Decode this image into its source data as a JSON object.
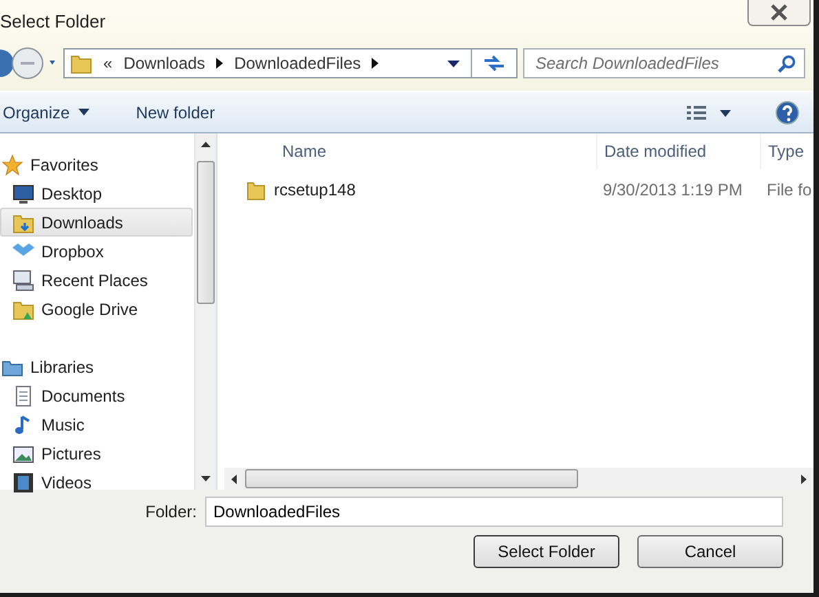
{
  "window": {
    "title": "Select Folder"
  },
  "address": {
    "crumbs": [
      "«",
      "Downloads",
      "DownloadedFiles"
    ]
  },
  "search": {
    "placeholder": "Search DownloadedFiles"
  },
  "toolbar": {
    "organize": "Organize",
    "new_folder": "New folder"
  },
  "nav": [
    {
      "kind": "group",
      "label": "Favorites",
      "selected": false
    },
    {
      "kind": "item",
      "label": "Desktop",
      "selected": false
    },
    {
      "kind": "item",
      "label": "Downloads",
      "selected": true
    },
    {
      "kind": "item",
      "label": "Dropbox",
      "selected": false
    },
    {
      "kind": "item",
      "label": "Recent Places",
      "selected": false
    },
    {
      "kind": "item",
      "label": "Google Drive",
      "selected": false
    },
    {
      "kind": "group",
      "label": "Libraries",
      "selected": false
    },
    {
      "kind": "item",
      "label": "Documents",
      "selected": false
    },
    {
      "kind": "item",
      "label": "Music",
      "selected": false
    },
    {
      "kind": "item",
      "label": "Pictures",
      "selected": false
    },
    {
      "kind": "item",
      "label": "Videos",
      "selected": false
    }
  ],
  "table": {
    "columns": [
      "Name",
      "Date modified",
      "Type"
    ],
    "rows": [
      {
        "name": "rcsetup148",
        "date": "9/30/2013 1:19 PM",
        "type": "File fo"
      }
    ]
  },
  "footer": {
    "folder_label": "Folder:",
    "folder_value": "DownloadedFiles",
    "buttons": [
      "Select Folder",
      "Cancel"
    ]
  }
}
